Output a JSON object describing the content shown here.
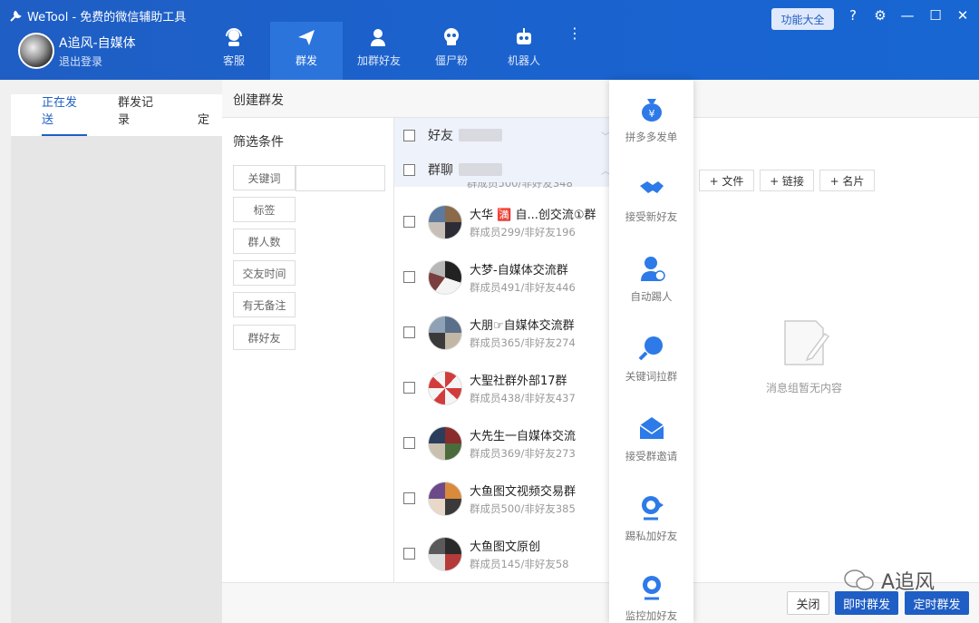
{
  "app": {
    "title": "WeTool - 免费的微信辅助工具",
    "user_name": "A追风-自媒体",
    "logout": "退出登录",
    "feature_button": "功能大全"
  },
  "nav": [
    {
      "label": "客服",
      "icon": "headset-icon"
    },
    {
      "label": "群发",
      "icon": "paper-plane-icon",
      "active": true
    },
    {
      "label": "加群好友",
      "icon": "add-friend-icon"
    },
    {
      "label": "僵尸粉",
      "icon": "skull-icon"
    },
    {
      "label": "机器人",
      "icon": "robot-icon"
    }
  ],
  "page_tabs": [
    {
      "label": "正在发送",
      "active": true
    },
    {
      "label": "群发记录"
    },
    {
      "label": "定"
    }
  ],
  "modal": {
    "title": "创建群发",
    "filter_title": "筛选条件",
    "filters": [
      "关键词",
      "标签",
      "群人数",
      "交友时间",
      "有无备注",
      "群好友"
    ],
    "categories": [
      "好友",
      "群聊"
    ],
    "partial_sub": "群成员500/非好友348",
    "groups": [
      {
        "name": "大华 🈵 自...创交流①群",
        "sub": "群成员299/非好友196"
      },
      {
        "name": "大梦-自媒体交流群",
        "sub": "群成员491/非好友446"
      },
      {
        "name": "大朋☞自媒体交流群",
        "sub": "群成员365/非好友274"
      },
      {
        "name": "大聖社群外部17群",
        "sub": "群成员438/非好友437"
      },
      {
        "name": "大先生一自媒体交流",
        "sub": "群成员369/非好友273"
      },
      {
        "name": "大鱼图文视频交易群",
        "sub": "群成员500/非好友385"
      },
      {
        "name": "大鱼图文原创",
        "sub": "群成员145/非好友58"
      }
    ],
    "attach_buttons": [
      "+ 文件",
      "+ 链接",
      "+ 名片"
    ],
    "empty_text": "消息组暂无内容",
    "close_button": "关闭",
    "send_now_button": "即时群发",
    "schedule_button": "定时群发"
  },
  "side_menu": [
    {
      "label": "拼多多发单",
      "icon": "money-bag-icon"
    },
    {
      "label": "接受新好友",
      "icon": "handshake-icon"
    },
    {
      "label": "自动踢人",
      "icon": "kick-user-icon"
    },
    {
      "label": "关键词拉群",
      "icon": "magnifier-icon"
    },
    {
      "label": "接受群邀请",
      "icon": "envelope-icon"
    },
    {
      "label": "踢私加好友",
      "icon": "webcam-icon"
    },
    {
      "label": "监控加好友",
      "icon": "monitor-cam-icon"
    }
  ],
  "watermark": "A追风",
  "colors": {
    "primary": "#1f5ec4",
    "titlebar": "#1a63cf",
    "nav_active": "#2b74dc",
    "icon_blue": "#2d7ae8"
  }
}
